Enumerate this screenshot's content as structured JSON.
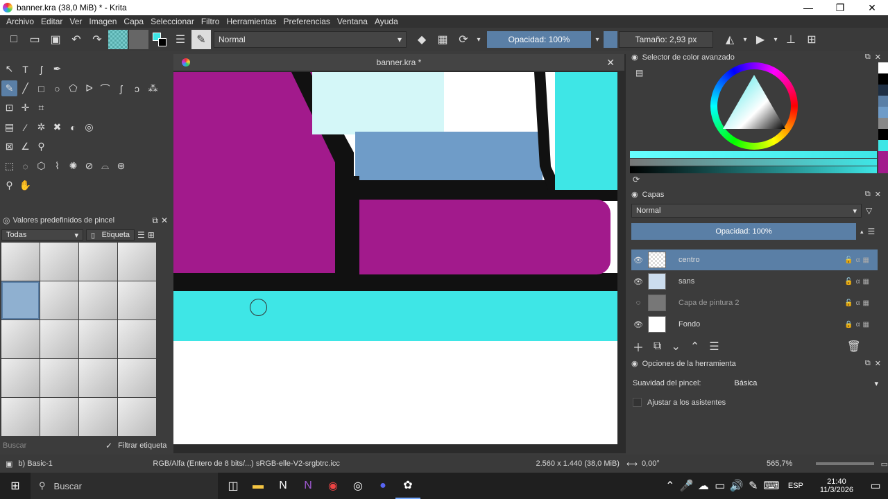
{
  "window": {
    "title": "banner.kra (38,0 MiB)  * - Krita",
    "min": "—",
    "max": "❐",
    "close": "✕"
  },
  "menu": [
    "Archivo",
    "Editar",
    "Ver",
    "Imagen",
    "Capa",
    "Seleccionar",
    "Filtro",
    "Herramientas",
    "Preferencias",
    "Ventana",
    "Ayuda"
  ],
  "toolbar": {
    "blend_mode": "Normal",
    "opacity": "Opacidad: 100%",
    "size": "Tamaño: 2,93 px"
  },
  "document": {
    "tab_title": "banner.kra *",
    "close": "✕"
  },
  "brush_presets": {
    "title": "Valores predefinidos de pincel",
    "filter": "Todas",
    "tag": "Etiqueta",
    "search_placeholder": "Buscar",
    "filter_tag": "Filtrar etiqueta"
  },
  "color_selector": {
    "title": "Selector de color avanzado"
  },
  "layers": {
    "title": "Capas",
    "blend_mode": "Normal",
    "opacity": "Opacidad:  100%",
    "items": [
      {
        "name": "centro"
      },
      {
        "name": "sans"
      },
      {
        "name": "Capa de pintura 2"
      },
      {
        "name": "Fondo"
      }
    ]
  },
  "tool_options": {
    "title": "Opciones de la herramienta",
    "smoothing_label": "Suavidad del pincel:",
    "smoothing_value": "Básica",
    "assistants": "Ajustar a los asistentes"
  },
  "status": {
    "preset": "b) Basic-1",
    "colorspace": "RGB/Alfa (Entero de 8 bits/...)  sRGB-elle-V2-srgbtrc.icc",
    "dimensions": "2.560 x 1.440 (38,0 MiB)",
    "rotation": "0,00°",
    "zoom": "565,7%"
  },
  "taskbar": {
    "search": "Buscar",
    "time": "21:40",
    "date": "11/3/2026",
    "lang": "ESP"
  },
  "colors": {
    "accent": "#5a7fa6",
    "magenta": "#a21a8c",
    "cyan": "#3ee6e6",
    "blue": "#6f9cc8",
    "lightcyan": "#d4f7f8"
  }
}
